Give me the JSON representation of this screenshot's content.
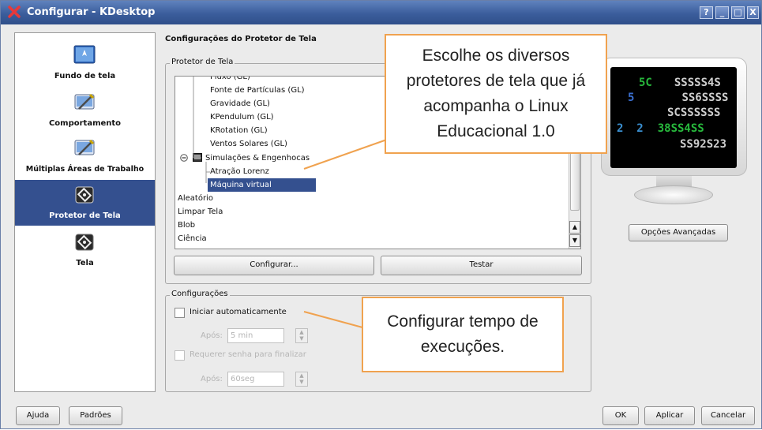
{
  "titlebar": {
    "title": "Configurar - KDesktop",
    "buttons": [
      "?",
      "_",
      "□",
      "X"
    ]
  },
  "sidebar": {
    "items": [
      {
        "label": "Fundo de tela",
        "icon": "wallpaper-icon"
      },
      {
        "label": "Comportamento",
        "icon": "behavior-icon"
      },
      {
        "label": "Múltiplas Áreas de Trabalho",
        "icon": "virtual-desktops-icon"
      },
      {
        "label": "Protetor de Tela",
        "icon": "screensaver-icon",
        "active": true
      },
      {
        "label": "Tela",
        "icon": "display-icon"
      }
    ]
  },
  "main": {
    "heading": "Configurações do Protetor de Tela",
    "screensaver_group_title": "Protetor de Tela",
    "list_items": [
      "Fluxo (GL)",
      "Fonte de Partículas (GL)",
      "Gravidade (GL)",
      "KPendulum (GL)",
      "KRotation (GL)",
      "Ventos Solares (GL)",
      "Simulações & Engenhocas",
      "Atração Lorenz",
      "Máquina virtual",
      "Aleatório",
      "Limpar Tela",
      "Blob",
      "Ciência"
    ],
    "selected_item": "Máquina virtual",
    "configure_button": "Configurar...",
    "test_button": "Testar",
    "advanced_button": "Opções Avançadas",
    "settings_group_title": "Configurações",
    "auto_start_label": "Iniciar automaticamente",
    "after_label_1": "Após:",
    "after_value_1": "5 min",
    "require_password_label": "Requerer senha para finalizar",
    "after_label_2": "Após:",
    "after_value_2": "60seg"
  },
  "preview": {
    "rows": [
      {
        "a": "5C",
        "b": "SSSSS4S"
      },
      {
        "a": "5",
        "b": "SS6SSSS"
      },
      {
        "a": "",
        "b": "SCSSSSSS"
      },
      {
        "a": "2  2",
        "b": "38SS4SS"
      },
      {
        "a": "",
        "b": "SS92S23"
      }
    ]
  },
  "callouts": {
    "top": "Escolhe os diversos protetores de tela que já acompanha o Linux Educacional 1.0",
    "bottom": "Configurar tempo de execuções."
  },
  "footer": {
    "help_button": "Ajuda",
    "defaults_button": "Padrões",
    "ok_button": "OK",
    "apply_button": "Aplicar",
    "cancel_button": "Cancelar"
  },
  "colors": {
    "titlebar": "#3b5d9c",
    "selection": "#34508f",
    "callout_border": "#f0a24f"
  }
}
